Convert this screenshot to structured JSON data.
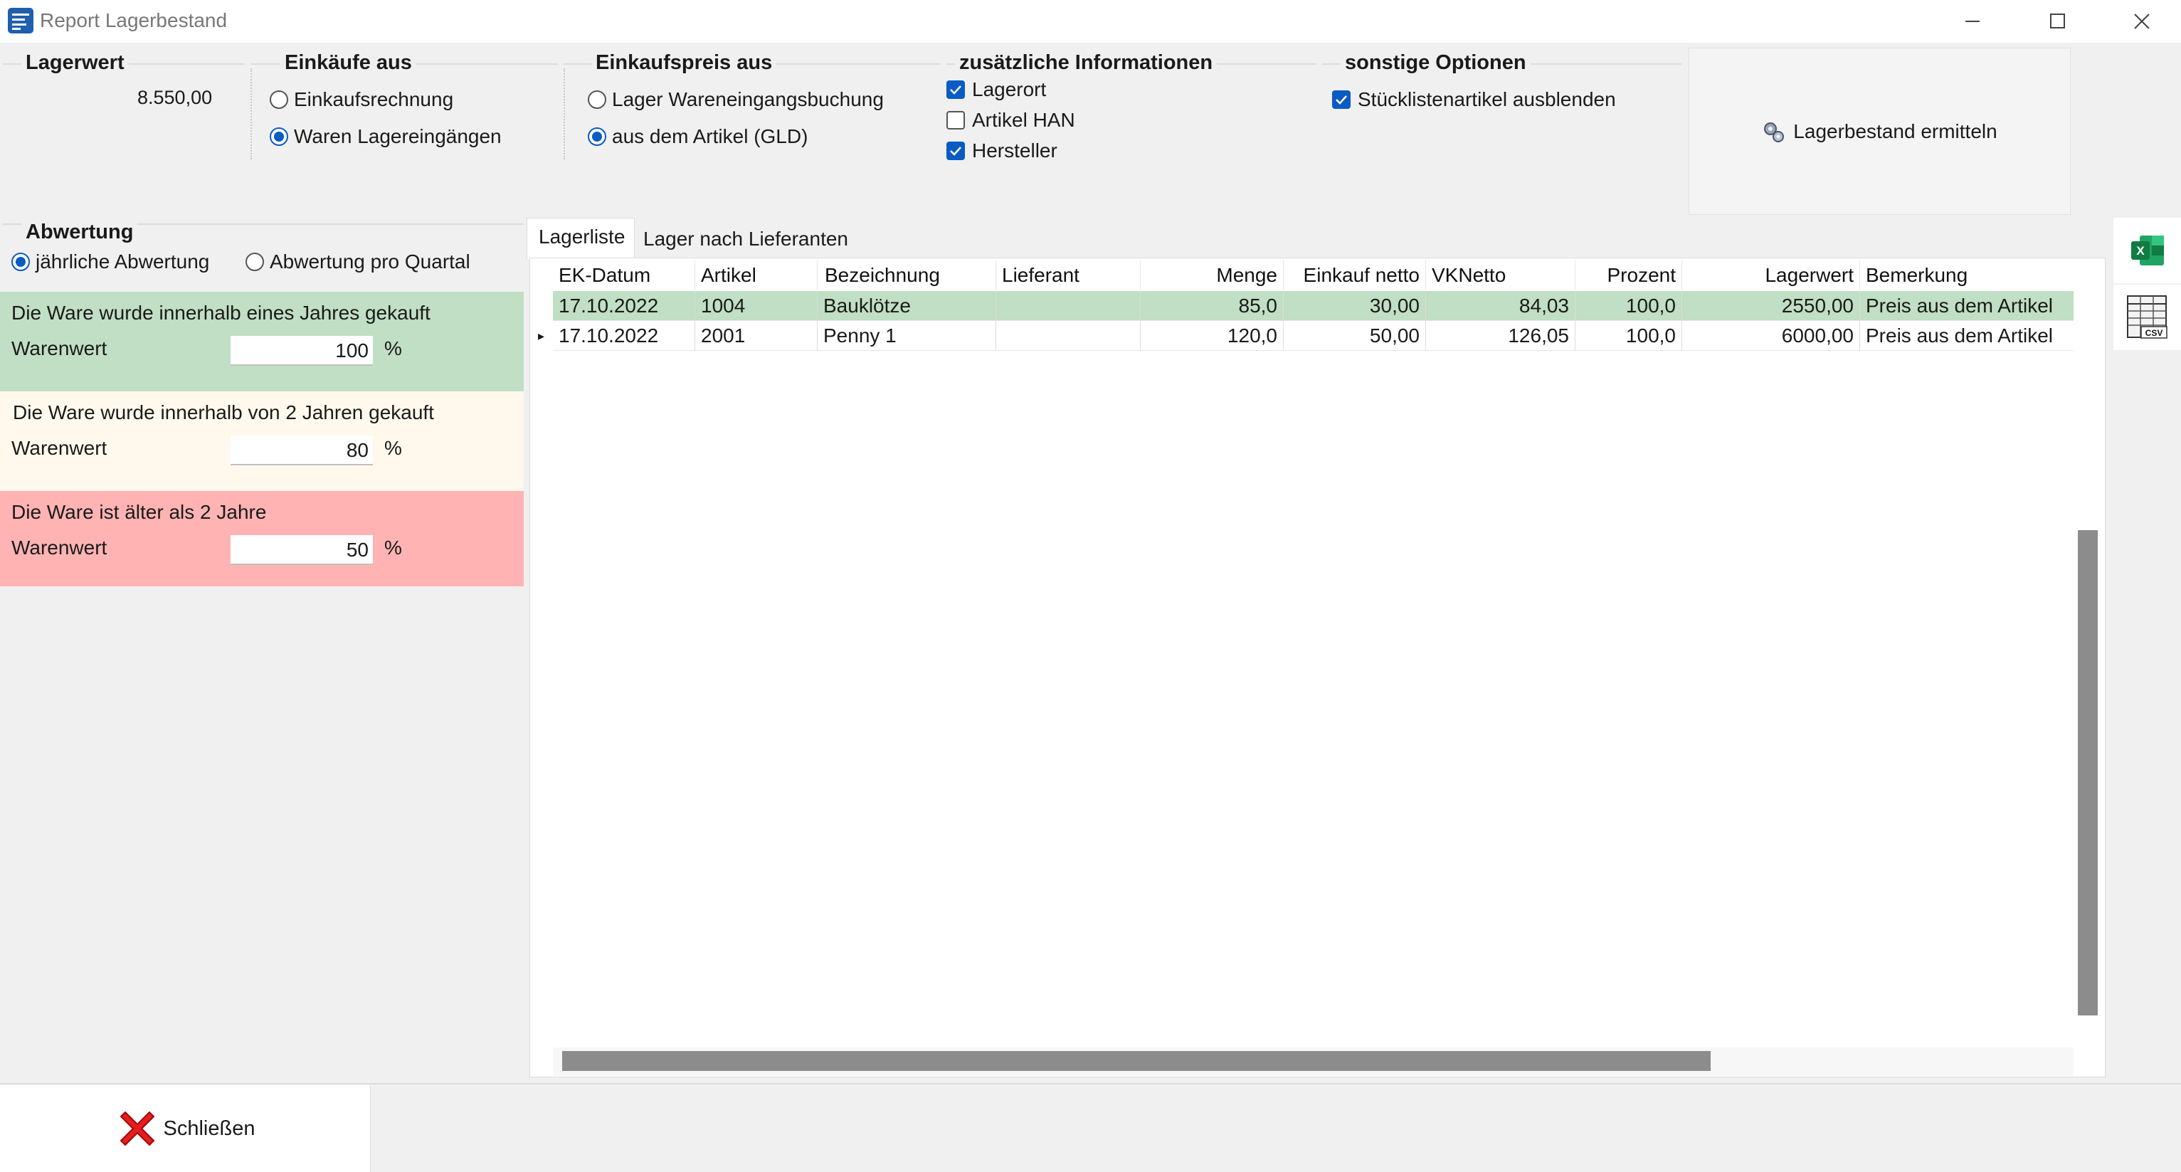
{
  "window": {
    "title": "Report Lagerbestand"
  },
  "lagerwert": {
    "heading": "Lagerwert",
    "value": "8.550,00"
  },
  "einkaeufe": {
    "heading": "Einkäufe aus",
    "options": [
      "Einkaufsrechnung",
      "Waren Lagereingängen"
    ],
    "selected": "Waren Lagereingängen"
  },
  "einkaufspreis": {
    "heading": "Einkaufspreis aus",
    "options": [
      "Lager Wareneingangsbuchung",
      "aus dem Artikel (GLD)"
    ],
    "selected": "aus dem Artikel (GLD)"
  },
  "zusatz": {
    "heading": "zusätzliche Informationen",
    "items": [
      {
        "label": "Lagerort",
        "checked": true
      },
      {
        "label": "Artikel HAN",
        "checked": false
      },
      {
        "label": "Hersteller",
        "checked": true
      }
    ]
  },
  "sonstige": {
    "heading": "sonstige Optionen",
    "items": [
      {
        "label": "Stücklistenartikel ausblenden",
        "checked": true
      }
    ]
  },
  "actions": {
    "ermitteln_label": "Lagerbestand ermitteln",
    "close_label": "Schließen",
    "side_icons": [
      "excel-export-icon",
      "csv-export-icon"
    ]
  },
  "abwertung": {
    "heading": "Abwertung",
    "modes": [
      "jährliche Abwertung",
      "Abwertung pro Quartal"
    ],
    "selected_mode": "jährliche Abwertung",
    "bands": [
      {
        "text": "Die Ware wurde innerhalb eines Jahres gekauft",
        "label": "Warenwert",
        "value": "100",
        "unit": "%",
        "color": "#c0dfc4"
      },
      {
        "text": "Die Ware wurde innerhalb von 2 Jahren gekauft",
        "label": "Warenwert",
        "value": "80",
        "unit": "%",
        "color": "#fff9ed"
      },
      {
        "text": "Die Ware ist älter als 2 Jahre",
        "label": "Warenwert",
        "value": "50",
        "unit": "%",
        "color": "#ffb3b3"
      }
    ]
  },
  "tabs": [
    "Lagerliste",
    "Lager nach Lieferanten"
  ],
  "active_tab": "Lagerliste",
  "grid": {
    "columns": [
      "EK-Datum",
      "Artikel",
      "Bezeichnung",
      "Lieferant",
      "Menge",
      "Einkauf netto",
      "VKNetto",
      "Prozent",
      "Lagerwert",
      "Bemerkung"
    ],
    "rows": [
      [
        "17.10.2022",
        "1004",
        "Bauklötze",
        "",
        "85,0",
        "30,00",
        "84,03",
        "100,0",
        "2550,00",
        "Preis aus dem Artikel"
      ],
      [
        "17.10.2022",
        "2001",
        "Penny 1",
        "",
        "120,0",
        "50,00",
        "126,05",
        "100,0",
        "6000,00",
        "Preis aus dem Artikel"
      ]
    ],
    "highlight_row_color": "#c0dfc4",
    "row_indicator": "▸"
  },
  "colors": {
    "accent": "#0a5bc4",
    "background": "#f0f0f0"
  }
}
